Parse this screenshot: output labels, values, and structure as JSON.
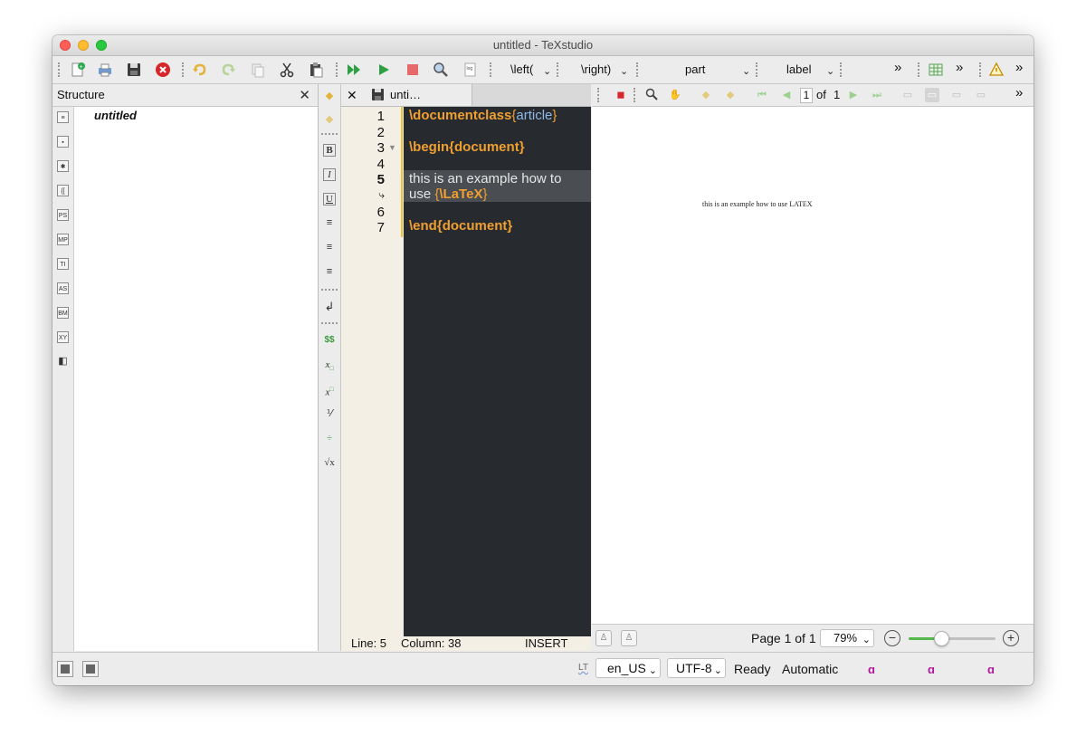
{
  "window": {
    "title": "untitled - TeXstudio"
  },
  "toolbar": {
    "left_label": "\\left(",
    "right_label": "\\right)",
    "part_label": "part",
    "label_label": "label",
    "more_glyph": "»"
  },
  "structure": {
    "title": "Structure",
    "close_glyph": "✕",
    "tree_root": "untitled",
    "side_icons": [
      "PS",
      "MP",
      "TI",
      "AS",
      "BM",
      "XY"
    ]
  },
  "editor": {
    "tab_label": "unti…",
    "tab_close_glyph": "✕",
    "line_numbers": [
      "1",
      "2",
      "3",
      "4",
      "5",
      "",
      "6",
      "7"
    ],
    "lines": {
      "l1_cmd": "\\documentclass",
      "l1_open": "{",
      "l1_arg": "article",
      "l1_close": "}",
      "l3_cmd": "\\begin",
      "l3_open": "{",
      "l3_arg": "document",
      "l3_close": "}",
      "l5_text": "this is an example how to",
      "l5b_text": "use ",
      "l5b_open": "{",
      "l5b_cmd": "\\LaTeX",
      "l5b_close": "}",
      "l7_cmd": "\\end",
      "l7_open": "{",
      "l7_arg": "document",
      "l7_close": "}"
    },
    "status": {
      "line": "Line: 5",
      "column": "Column: 38",
      "mode": "INSERT"
    }
  },
  "pdf": {
    "page_input": "1",
    "of_label": "of",
    "total_pages": "1",
    "page_text": "this is an example how to use LATEX",
    "page_status": "Page 1 of 1",
    "zoom": "79%",
    "zoom_level": 0.38
  },
  "statusbar": {
    "lt_label": "LT",
    "language": "en_US",
    "encoding": "UTF-8",
    "state": "Ready",
    "mode": "Automatic"
  },
  "colors": {
    "editor_bg": "#272a2f",
    "keyword": "#f0a030",
    "argument": "#8fb8e6",
    "gutter_bg": "#f3efe4"
  }
}
